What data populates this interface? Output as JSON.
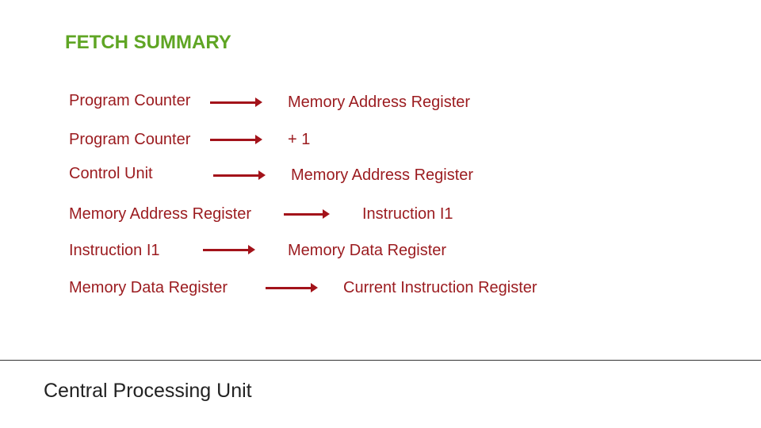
{
  "slide": {
    "title": "FETCH SUMMARY",
    "title_color": "#5fa524",
    "text_color": "#9b1b1f",
    "arrow_color": "#a3131a",
    "footer": "Central Processing Unit",
    "steps": [
      {
        "from": "Program Counter",
        "to": "Memory Address Register"
      },
      {
        "from": "Program Counter",
        "to": "+ 1"
      },
      {
        "from": "Control Unit",
        "to": "Memory Address Register"
      },
      {
        "from": "Memory Address Register",
        "to": "Instruction I1"
      },
      {
        "from": "Instruction I1",
        "to": "Memory Data Register"
      },
      {
        "from": "Memory Data Register",
        "to": "Current Instruction Register"
      }
    ]
  }
}
